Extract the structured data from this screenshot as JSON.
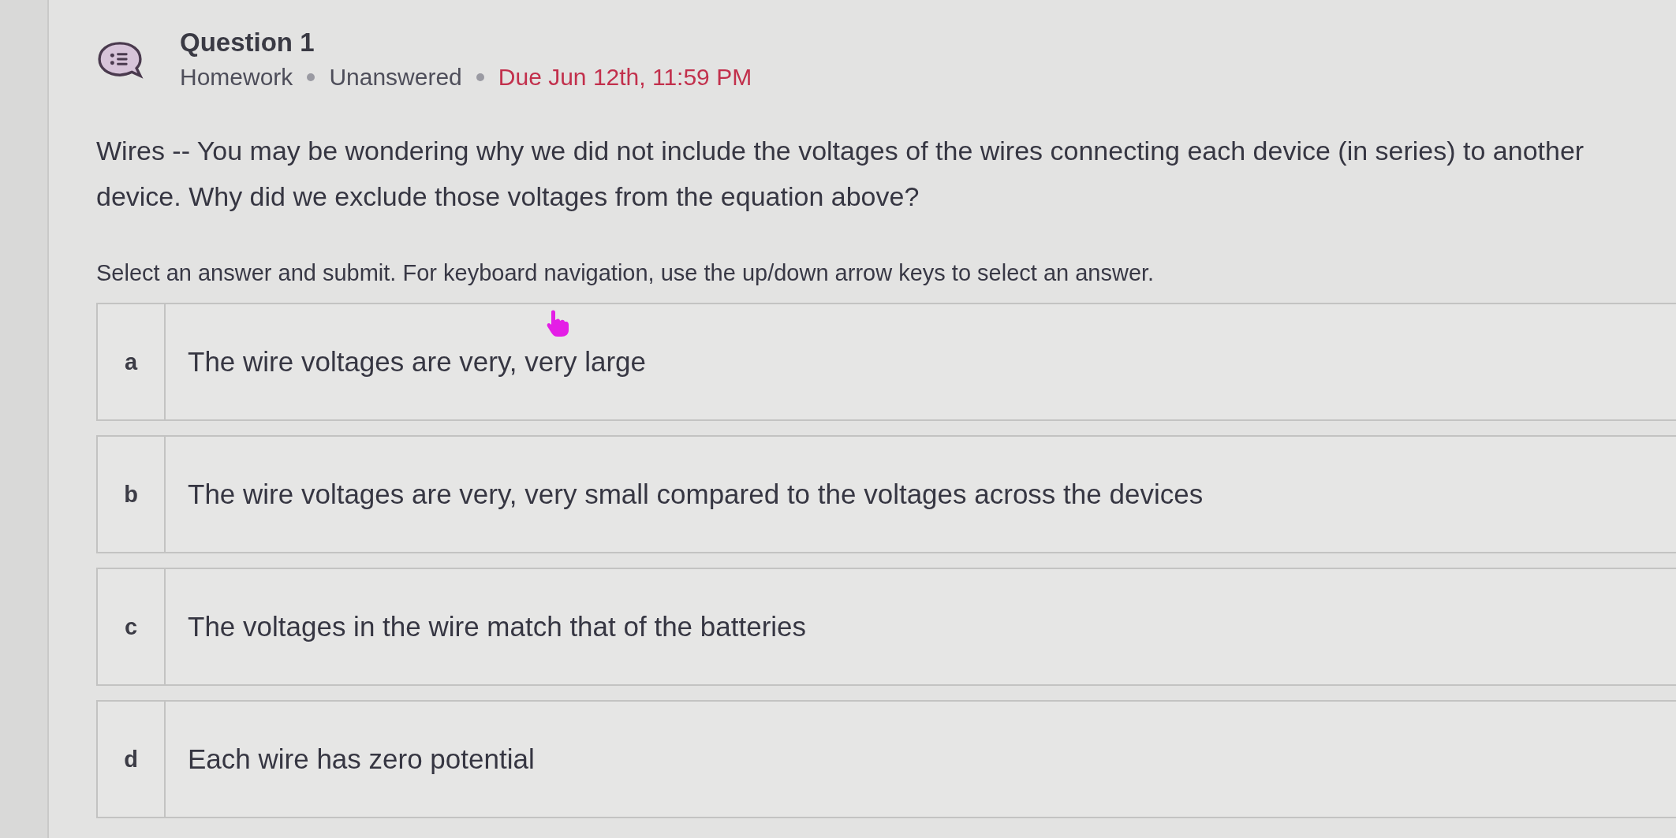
{
  "question": {
    "title": "Question 1",
    "meta": [
      {
        "text": "Homework",
        "kind": "type"
      },
      {
        "text": "Unanswered",
        "kind": "status"
      },
      {
        "text": "Due Jun 12th, 11:59 PM",
        "kind": "due"
      }
    ],
    "prompt": "Wires -- You may be wondering why we did not include the voltages of the wires connecting each device (in series) to another device. Why did we exclude those voltages from the equation above?",
    "instruction": "Select an answer and submit. For keyboard navigation, use the up/down arrow keys to select an answer."
  },
  "options": [
    {
      "letter": "a",
      "text": "The wire voltages are very, very large",
      "selected": false
    },
    {
      "letter": "b",
      "text": "The wire voltages are very, very small compared to the voltages across the devices",
      "selected": false
    },
    {
      "letter": "c",
      "text": "The voltages in the wire match that of the batteries",
      "selected": false
    },
    {
      "letter": "d",
      "text": "Each wire has zero potential",
      "selected": false
    }
  ]
}
